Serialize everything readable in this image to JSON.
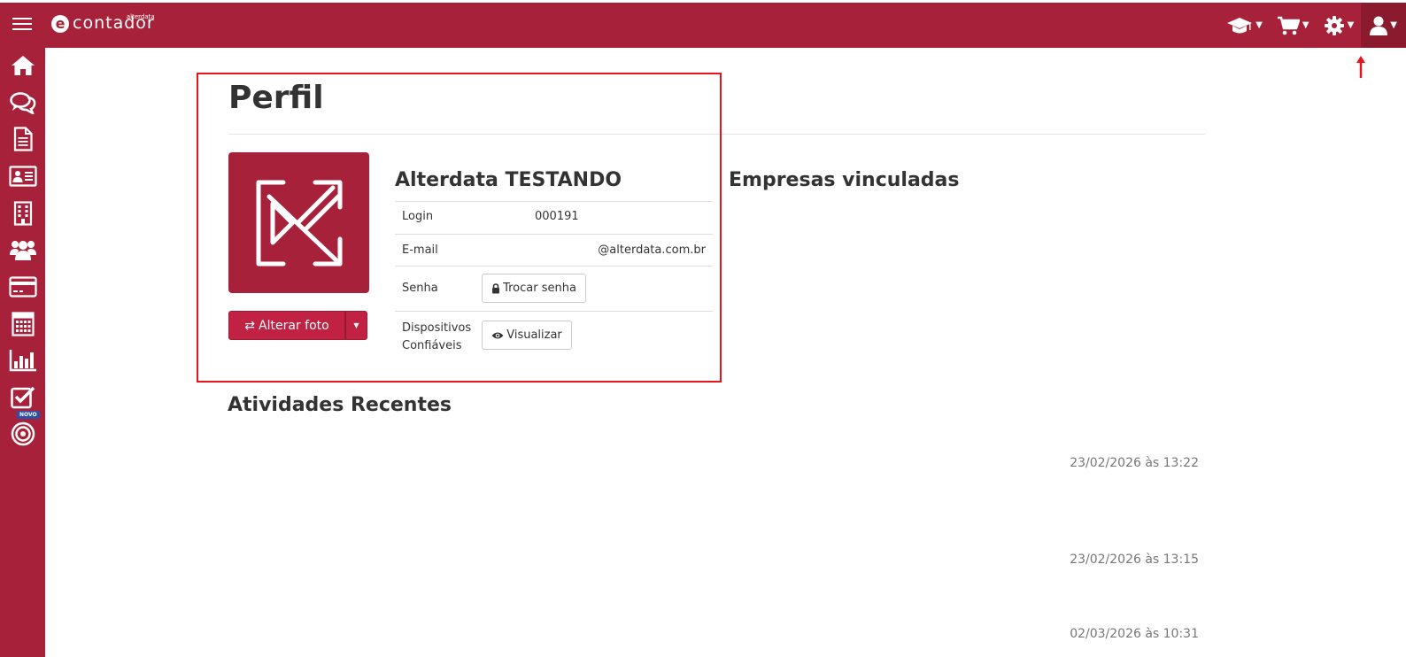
{
  "header": {
    "logo_small": "alterdata",
    "logo_text": "contador",
    "icons": [
      "graduation-cap-icon",
      "shopping-cart-icon",
      "gear-icon",
      "user-icon"
    ]
  },
  "sidebar": {
    "items": [
      "home-icon",
      "chat-icon",
      "document-icon",
      "id-card-icon",
      "building-icon",
      "users-icon",
      "credit-card-icon",
      "calculator-icon",
      "bar-chart-icon",
      "checkbox-icon",
      "target-icon"
    ],
    "novo_badge": "NOVO"
  },
  "profile": {
    "title": "Perfil",
    "change_photo_label": "Alterar foto",
    "user_name": "Alterdata TESTANDO",
    "rows": {
      "login_label": "Login",
      "login_value": "000191",
      "email_label": "E-mail",
      "email_value": "@alterdata.com.br",
      "password_label": "Senha",
      "change_password_label": "Trocar senha",
      "devices_label_line1": "Dispositivos",
      "devices_label_line2": "Confiáveis",
      "view_label": "Visualizar"
    }
  },
  "linked_companies": {
    "title": "Empresas vinculadas"
  },
  "recent_activities": {
    "title": "Atividades Recentes",
    "dates": [
      "23/02/2026 às 13:22",
      "23/02/2026 às 13:15",
      "02/03/2026 às 10:31"
    ]
  },
  "colors": {
    "brand": "#a8213a",
    "button": "#c12143",
    "highlight": "#e8141b"
  }
}
